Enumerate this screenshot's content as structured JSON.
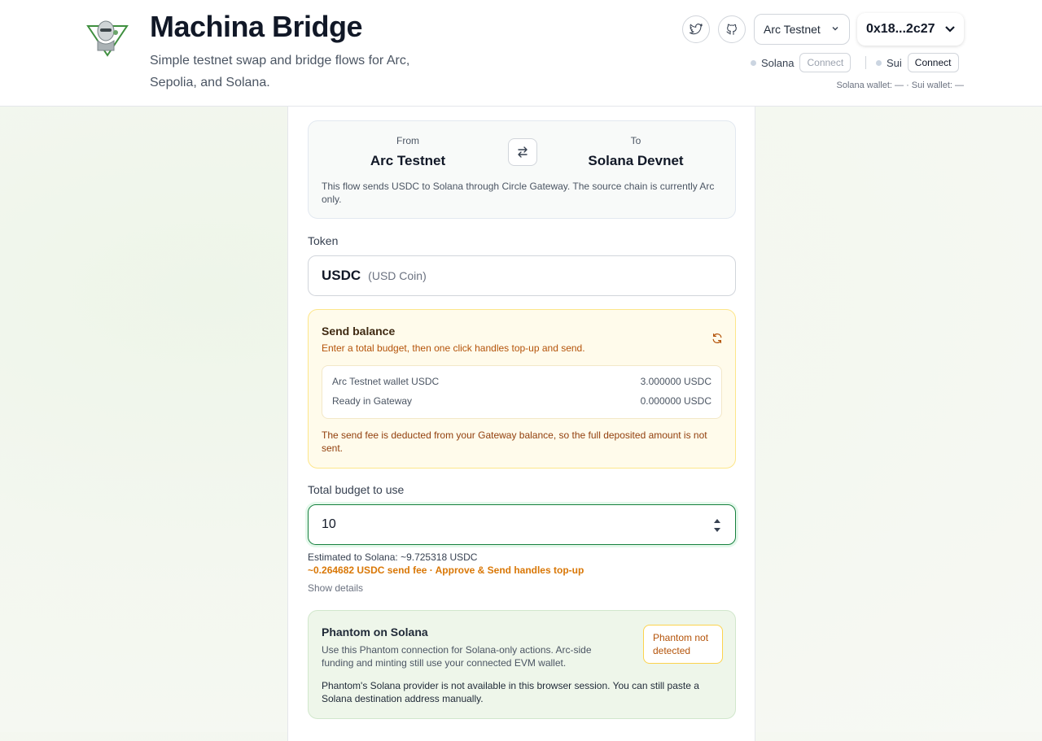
{
  "header": {
    "title": "Machina Bridge",
    "subtitle": "Simple testnet swap and bridge flows for Arc, Sepolia, and Solana.",
    "network_select": "Arc Testnet",
    "account": "0x18...2c27",
    "wallets": {
      "solana_label": "Solana",
      "solana_button": "Connect",
      "sui_label": "Sui",
      "sui_button": "Connect",
      "status": "Solana wallet: — · Sui wallet: —"
    },
    "icons": [
      "twitter-icon",
      "github-icon"
    ]
  },
  "route": {
    "from_label": "From",
    "from_chain": "Arc Testnet",
    "to_label": "To",
    "to_chain": "Solana Devnet",
    "note": "This flow sends USDC to Solana through Circle Gateway. The source chain is currently Arc only."
  },
  "token": {
    "label": "Token",
    "symbol": "USDC",
    "name": "(USD Coin)"
  },
  "balance": {
    "title": "Send balance",
    "desc": "Enter a total budget, then one click handles top-up and send.",
    "rows": [
      {
        "label": "Arc Testnet wallet USDC",
        "value": "3.000000 USDC"
      },
      {
        "label": "Ready in Gateway",
        "value": "0.000000 USDC"
      }
    ],
    "warning": "The send fee is deducted from your Gateway balance, so the full deposited amount is not sent."
  },
  "budget": {
    "label": "Total budget to use",
    "value": "10",
    "estimate": "Estimated to Solana: ~9.725318 USDC",
    "fee": "~0.264682 USDC send fee · Approve & Send handles top-up",
    "details": "Show details"
  },
  "phantom": {
    "title": "Phantom on Solana",
    "desc": "Use this Phantom connection for Solana-only actions. Arc-side funding and minting still use your connected EVM wallet.",
    "badge": "Phantom not detected",
    "info": "Phantom's Solana provider is not available in this browser session. You can still paste a Solana destination address manually."
  },
  "colors": {
    "accent_green": "#15803d",
    "warning_amber": "#d97706",
    "balance_bg": "#fffbeb",
    "phantom_bg": "#eef6ea"
  }
}
